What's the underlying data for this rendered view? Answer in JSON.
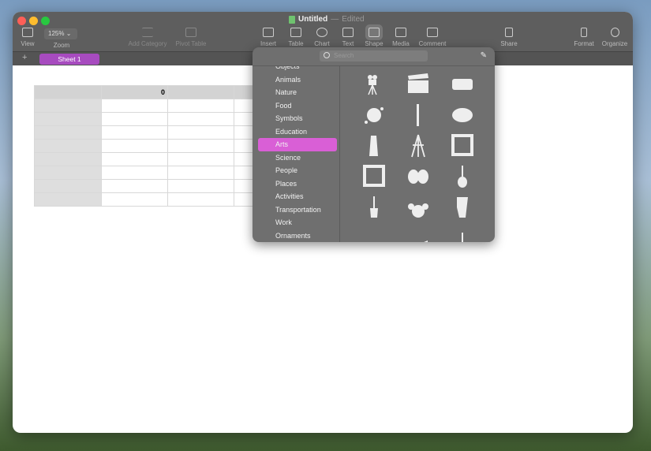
{
  "window": {
    "title": "Untitled",
    "status": "Edited"
  },
  "toolbar": {
    "view": "View",
    "zoom_value": "125%",
    "zoom": "Zoom",
    "add_category": "Add Category",
    "pivot_table": "Pivot Table",
    "insert": "Insert",
    "table": "Table",
    "chart": "Chart",
    "text": "Text",
    "shape": "Shape",
    "media": "Media",
    "comment": "Comment",
    "share": "Share",
    "format": "Format",
    "organize": "Organize"
  },
  "sheets": {
    "add": "+",
    "tabs": [
      "Sheet 1"
    ]
  },
  "table": {
    "header": [
      "",
      "0",
      "",
      "",
      ""
    ],
    "rows": 8
  },
  "shapes_popover": {
    "search_placeholder": "Search",
    "categories": [
      "Objects",
      "Animals",
      "Nature",
      "Food",
      "Symbols",
      "Education",
      "Arts",
      "Science",
      "People",
      "Places",
      "Activities",
      "Transportation",
      "Work",
      "Ornaments"
    ],
    "selected": "Arts",
    "icons": [
      "movie-camera",
      "clapperboard",
      "film-ticket",
      "paint-splatter",
      "paintbrush",
      "palette",
      "paint-tube",
      "easel",
      "picture-frame-square",
      "picture-frame-ornate",
      "theater-masks",
      "acoustic-guitar",
      "electric-guitar",
      "drum-kit",
      "conga-drum",
      "piano-keyboard",
      "grand-piano",
      "banjo"
    ]
  },
  "colors": {
    "accent": "#d95fd6",
    "sheet_tab": "#a74bbf"
  }
}
